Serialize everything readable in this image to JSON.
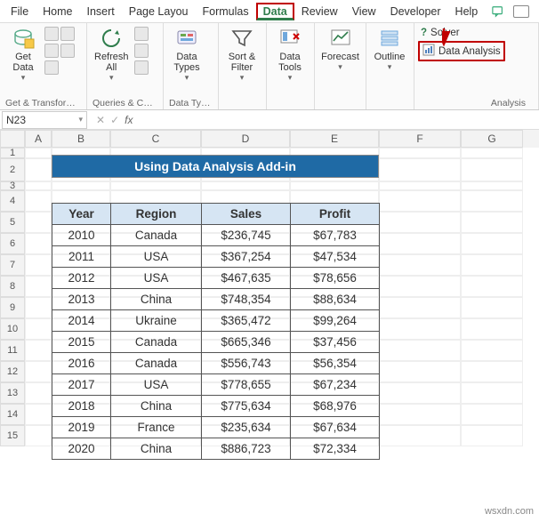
{
  "tabs": {
    "file": "File",
    "home": "Home",
    "insert": "Insert",
    "page_layout": "Page Layou",
    "formulas": "Formulas",
    "data": "Data",
    "review": "Review",
    "view": "View",
    "developer": "Developer",
    "help": "Help"
  },
  "ribbon": {
    "get_data": "Get\nData",
    "refresh_all": "Refresh\nAll",
    "data_types": "Data\nTypes",
    "sort_filter": "Sort &\nFilter",
    "data_tools": "Data\nTools",
    "forecast": "Forecast",
    "outline": "Outline",
    "solver": "Solver",
    "data_analysis": "Data Analysis",
    "groups": {
      "get_transform": "Get & Transform…",
      "queries": "Queries & Co…",
      "data_types": "Data Types",
      "analysis": "Analysis"
    }
  },
  "namebox": "N23",
  "formula": "",
  "columns": [
    "A",
    "B",
    "C",
    "D",
    "E",
    "F",
    "G"
  ],
  "row_heights": {
    "r1": 12,
    "r2": 26,
    "r3": 10,
    "r4_plus": 24
  },
  "banner": "Using Data Analysis Add-in",
  "table": {
    "headers": [
      "Year",
      "Region",
      "Sales",
      "Profit"
    ],
    "rows": [
      [
        "2010",
        "Canada",
        "$236,745",
        "$67,783"
      ],
      [
        "2011",
        "USA",
        "$367,254",
        "$47,534"
      ],
      [
        "2012",
        "USA",
        "$467,635",
        "$78,656"
      ],
      [
        "2013",
        "China",
        "$748,354",
        "$88,634"
      ],
      [
        "2014",
        "Ukraine",
        "$365,472",
        "$99,264"
      ],
      [
        "2015",
        "Canada",
        "$665,346",
        "$37,456"
      ],
      [
        "2016",
        "Canada",
        "$556,743",
        "$56,354"
      ],
      [
        "2017",
        "USA",
        "$778,655",
        "$67,234"
      ],
      [
        "2018",
        "China",
        "$775,634",
        "$68,976"
      ],
      [
        "2019",
        "France",
        "$235,634",
        "$67,634"
      ],
      [
        "2020",
        "China",
        "$886,723",
        "$72,334"
      ]
    ]
  },
  "watermark": "wsxdn.com"
}
